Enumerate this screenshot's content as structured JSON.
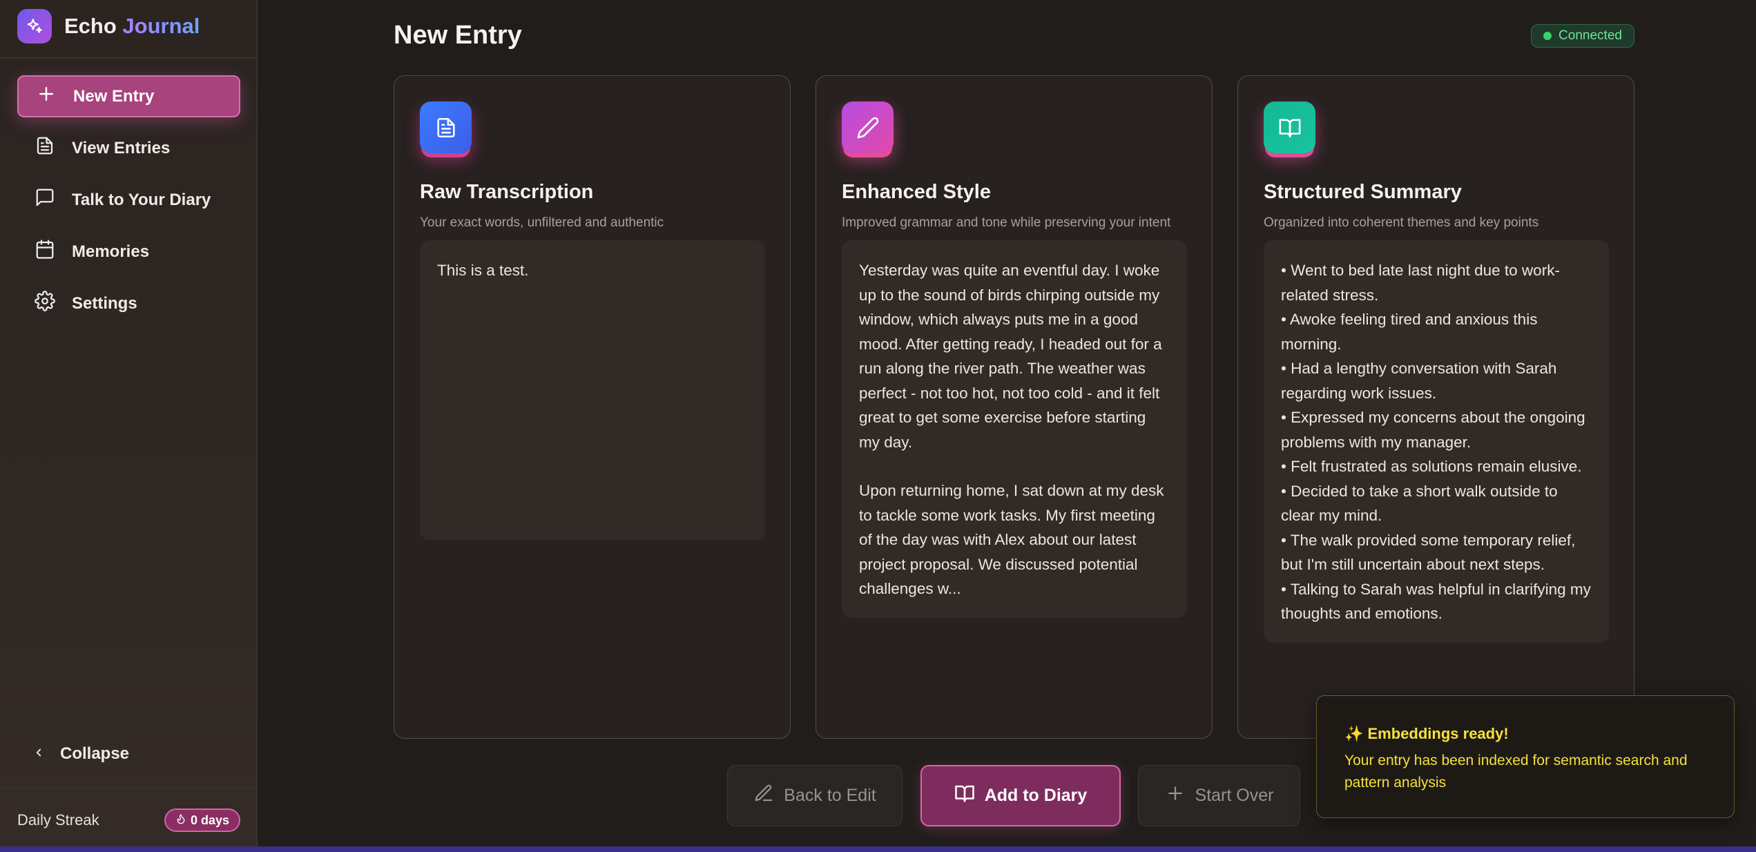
{
  "app": {
    "name_primary": "Echo",
    "name_accent": "Journal",
    "logo_icon": "sparkles-icon"
  },
  "sidebar": {
    "items": [
      {
        "label": "New Entry",
        "icon": "plus-icon",
        "active": true
      },
      {
        "label": "View Entries",
        "icon": "file-text-icon",
        "active": false
      },
      {
        "label": "Talk to Your Diary",
        "icon": "message-square-icon",
        "active": false
      },
      {
        "label": "Memories",
        "icon": "calendar-icon",
        "active": false
      },
      {
        "label": "Settings",
        "icon": "gear-icon",
        "active": false
      }
    ],
    "collapse_label": "Collapse",
    "streak_label": "Daily Streak",
    "streak_value": "0 days"
  },
  "header": {
    "title": "New Entry",
    "status": "Connected",
    "status_color": "#36d46d"
  },
  "cards": [
    {
      "title": "Raw Transcription",
      "subtitle": "Your exact words, unfiltered and authentic",
      "icon": "document-icon",
      "content": [
        "This is a test."
      ]
    },
    {
      "title": "Enhanced Style",
      "subtitle": "Improved grammar and tone while preserving your intent",
      "icon": "pencil-icon",
      "content": [
        "Yesterday was quite an eventful day. I woke up to the sound of birds chirping outside my window, which always puts me in a good mood. After getting ready, I headed out for a run along the river path. The weather was perfect - not too hot, not too cold - and it felt great to get some exercise before starting my day.",
        "Upon returning home, I sat down at my desk to tackle some work tasks. My first meeting of the day was with Alex about our latest project proposal. We discussed potential challenges w..."
      ]
    },
    {
      "title": "Structured Summary",
      "subtitle": "Organized into coherent themes and key points",
      "icon": "book-open-icon",
      "bullets": [
        "• Went to bed late last night due to work-related stress.",
        "• Awoke feeling tired and anxious this morning.",
        "• Had a lengthy conversation with Sarah regarding work issues.",
        "• Expressed my concerns about the ongoing problems with my manager.",
        "• Felt frustrated as solutions remain elusive.",
        "• Decided to take a short walk outside to clear my mind.",
        "• The walk provided some temporary relief, but I'm still uncertain about next steps.",
        "• Talking to Sarah was helpful in clarifying my thoughts and emotions."
      ]
    }
  ],
  "actions": {
    "back_label": "Back to Edit",
    "add_label": "Add to Diary",
    "start_over_label": "Start Over"
  },
  "toast": {
    "title": "✨ Embeddings ready!",
    "message": "Your entry has been indexed for semantic search and pattern analysis"
  },
  "colors": {
    "accent": "#a7437d",
    "toast_text": "#f5e13a"
  }
}
